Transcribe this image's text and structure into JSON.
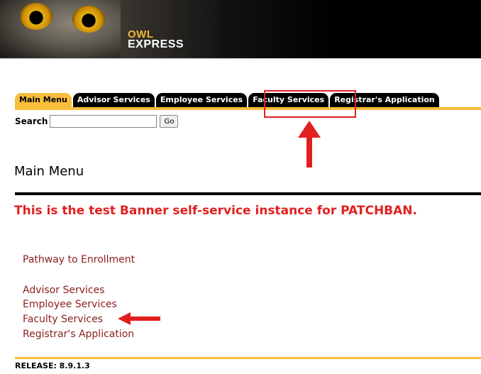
{
  "header": {
    "logo_line1": "OWL",
    "logo_line2": "EXPRESS"
  },
  "tabs": [
    {
      "label": "Main Menu",
      "active": true
    },
    {
      "label": "Advisor Services",
      "active": false
    },
    {
      "label": "Employee Services",
      "active": false
    },
    {
      "label": "Faculty Services",
      "active": false
    },
    {
      "label": "Registrar's Application",
      "active": false
    }
  ],
  "search": {
    "label": "Search",
    "value": "",
    "go_label": "Go"
  },
  "main": {
    "title": "Main Menu",
    "notice": "This is the test Banner self-service instance for PATCHBAN.",
    "links": [
      "Pathway to Enrollment",
      "Advisor Services",
      "Employee Services",
      "Faculty Services",
      "Registrar's Application"
    ]
  },
  "footer": {
    "release": "RELEASE: 8.9.1.3"
  },
  "colors": {
    "tab_active": "#f7be3c",
    "tab_inactive": "#000000",
    "link": "#8c1d1d",
    "notice": "#e21f1f",
    "annotation": "#e21f1f"
  }
}
